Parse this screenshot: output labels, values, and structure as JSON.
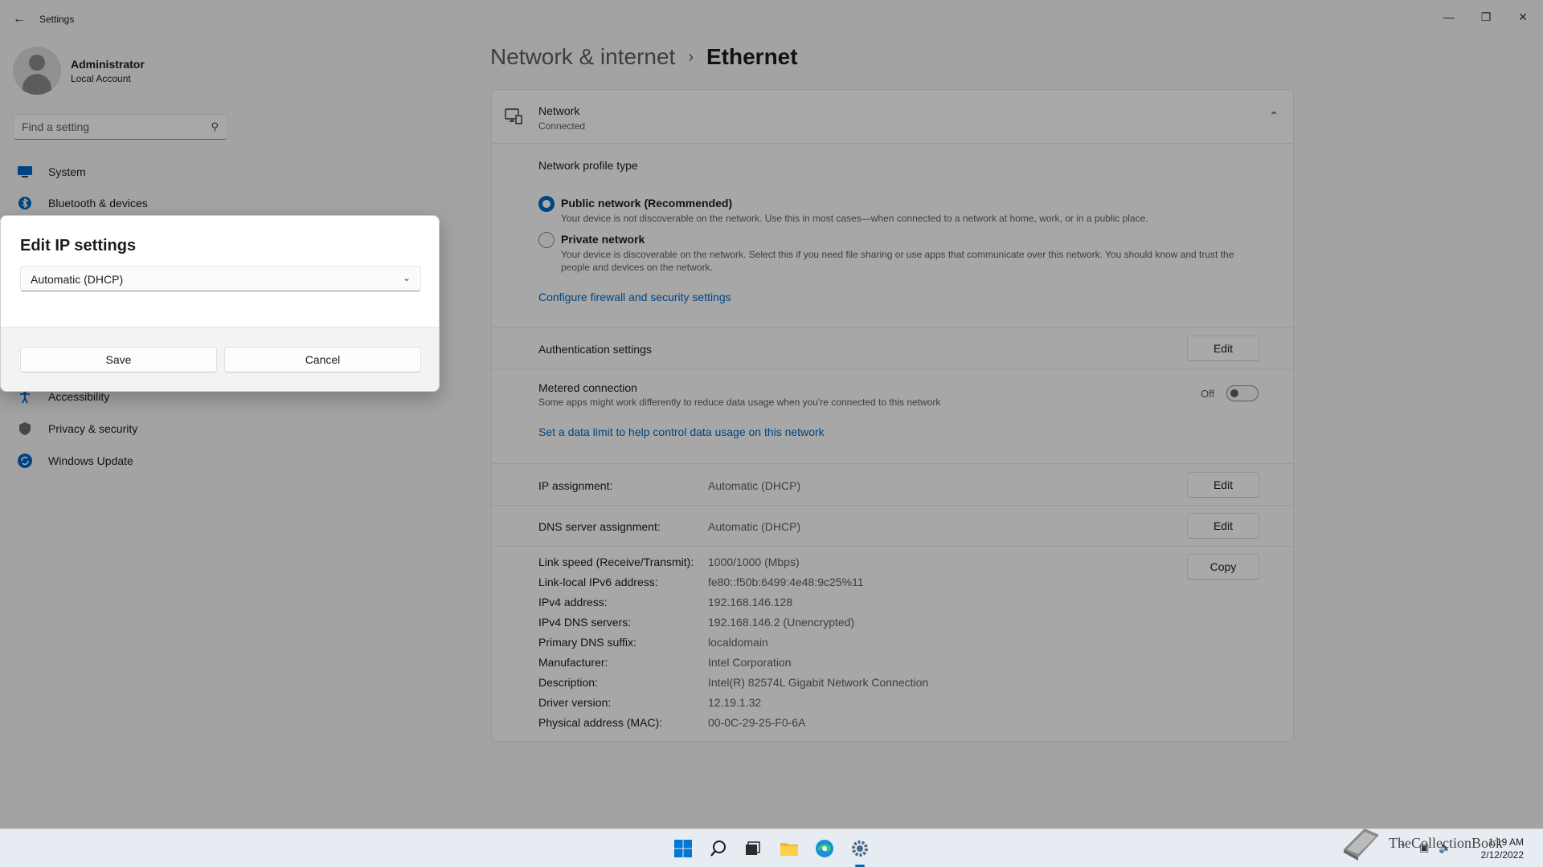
{
  "window": {
    "title": "Settings"
  },
  "profile": {
    "name": "Administrator",
    "account_type": "Local Account"
  },
  "search": {
    "placeholder": "Find a setting"
  },
  "sidebar": {
    "items": [
      {
        "label": "System",
        "icon": "monitor-icon",
        "color": "#0067c0"
      },
      {
        "label": "Bluetooth & devices",
        "icon": "bluetooth-icon",
        "color": "#0067c0"
      },
      {
        "label": "Accessibility",
        "icon": "accessibility-icon",
        "color": "#0067c0"
      },
      {
        "label": "Privacy & security",
        "icon": "shield-icon",
        "color": "#6b6b6b"
      },
      {
        "label": "Windows Update",
        "icon": "update-icon",
        "color": "#0067c0"
      }
    ]
  },
  "breadcrumb": {
    "parent": "Network & internet",
    "separator": "›",
    "current": "Ethernet"
  },
  "network_card": {
    "title": "Network",
    "status": "Connected"
  },
  "profile_type": {
    "heading": "Network profile type",
    "public_label": "Public network (Recommended)",
    "public_desc": "Your device is not discoverable on the network. Use this in most cases—when connected to a network at home, work, or in a public place.",
    "private_label": "Private network",
    "private_desc_1": "Your device is discoverable on the network. Select this if you need file sharing or use apps that communicate over this network. You should know and trust the",
    "private_desc_2": "people and devices on the network.",
    "selected": "public",
    "firewall_link": "Configure firewall and security settings"
  },
  "auth": {
    "label": "Authentication settings",
    "button": "Edit"
  },
  "metered": {
    "label": "Metered connection",
    "desc": "Some apps might work differently to reduce data usage when you're connected to this network",
    "state": "Off",
    "link": "Set a data limit to help control data usage on this network"
  },
  "ip_assignment": {
    "label": "IP assignment:",
    "value": "Automatic (DHCP)",
    "button": "Edit"
  },
  "dns_assignment": {
    "label": "DNS server assignment:",
    "value": "Automatic (DHCP)",
    "button": "Edit"
  },
  "properties": {
    "copy_button": "Copy",
    "rows": [
      {
        "label": "Link speed (Receive/Transmit):",
        "value": "1000/1000 (Mbps)"
      },
      {
        "label": "Link-local IPv6 address:",
        "value": "fe80::f50b:6499:4e48:9c25%11"
      },
      {
        "label": "IPv4 address:",
        "value": "192.168.146.128"
      },
      {
        "label": "IPv4 DNS servers:",
        "value": "192.168.146.2 (Unencrypted)"
      },
      {
        "label": "Primary DNS suffix:",
        "value": "localdomain"
      },
      {
        "label": "Manufacturer:",
        "value": "Intel Corporation"
      },
      {
        "label": "Description:",
        "value": "Intel(R) 82574L Gigabit Network Connection"
      },
      {
        "label": "Driver version:",
        "value": "12.19.1.32"
      },
      {
        "label": "Physical address (MAC):",
        "value": "00-0C-29-25-F0-6A"
      }
    ]
  },
  "dialog": {
    "title": "Edit IP settings",
    "selected_option": "Automatic (DHCP)",
    "save": "Save",
    "cancel": "Cancel"
  },
  "taskbar": {
    "time": "1:19 AM",
    "date": "2/12/2022",
    "watermark": "TheCollectionBook"
  },
  "colors": {
    "accent": "#0067c0",
    "link": "#0067c0"
  }
}
